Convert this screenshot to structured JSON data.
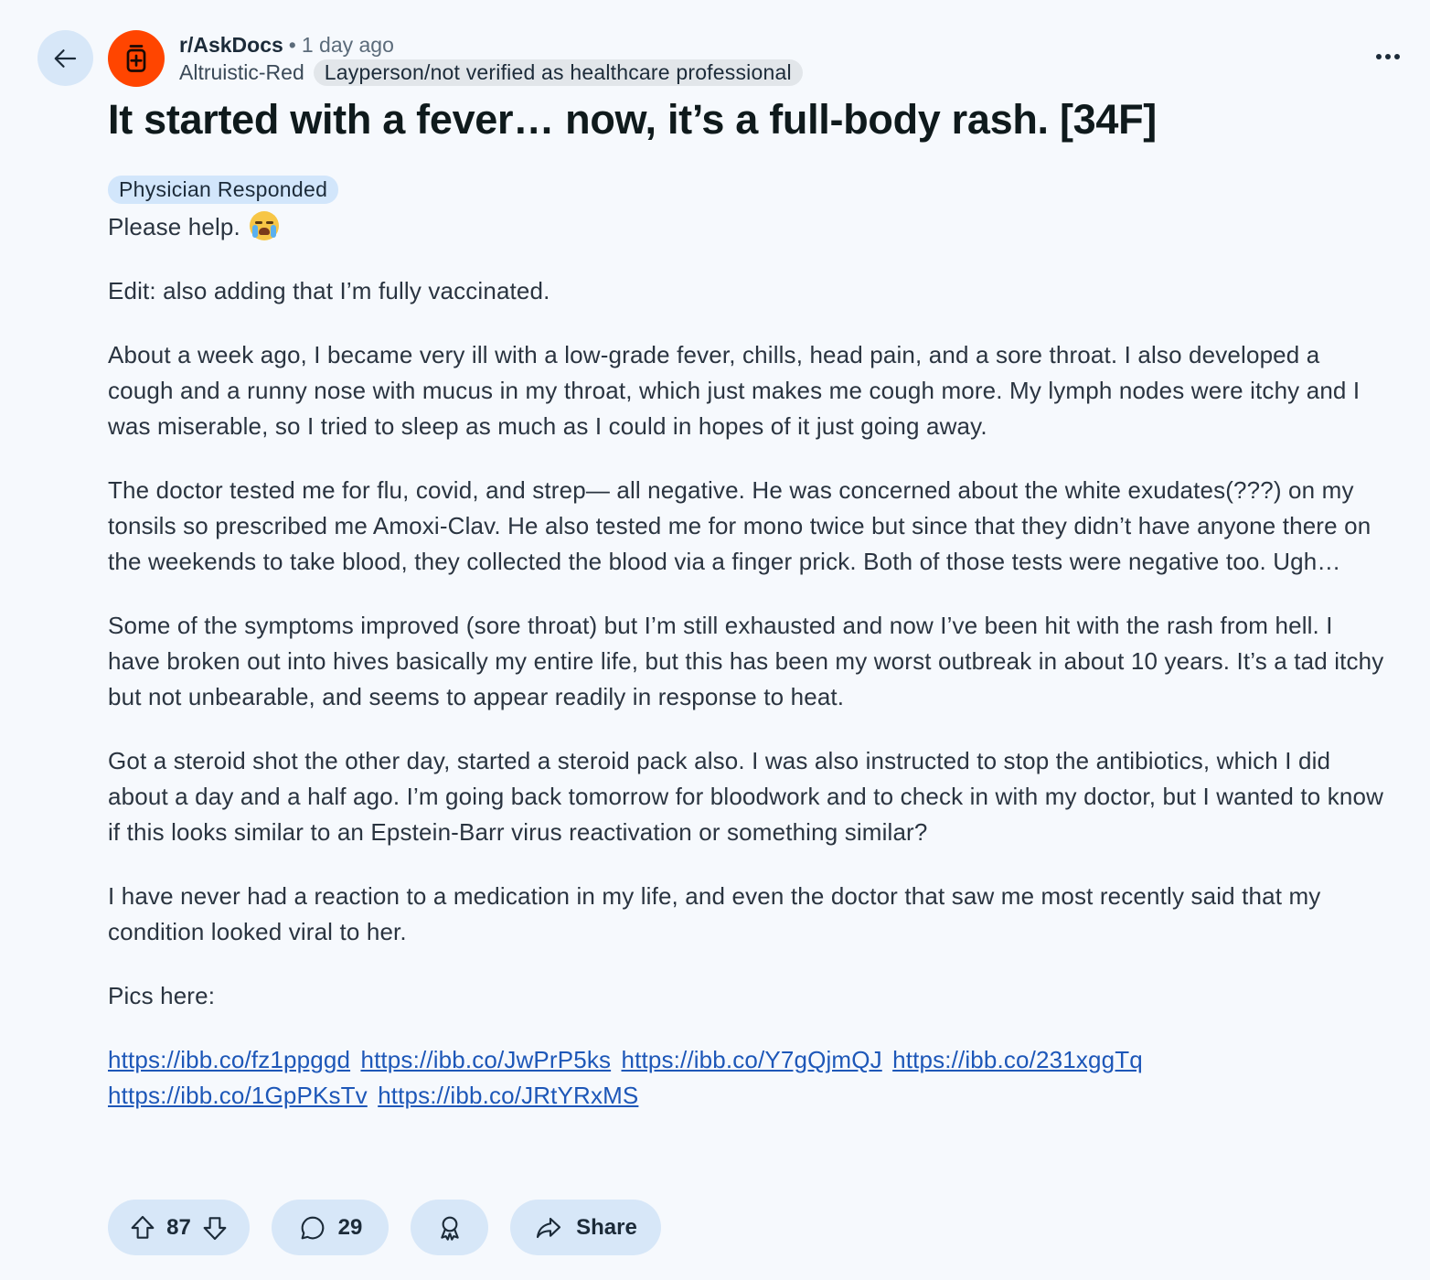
{
  "header": {
    "subreddit": "r/AskDocs",
    "separator": "•",
    "time_ago": "1 day ago",
    "author": "Altruistic-Red",
    "user_flair": "Layperson/not verified as healthcare professional",
    "avatar_color": "#ff4500"
  },
  "post": {
    "title": "It started with a fever… now, it’s a full-body rash. [34F]",
    "flair": "Physician Responded",
    "paragraphs": [
      "Please help.",
      "Edit: also adding that I’m fully vaccinated.",
      "About a week ago, I became very ill with a low-grade fever, chills, head pain, and a sore throat. I also developed a cough and a runny nose with mucus in my throat, which just makes me cough more. My lymph nodes were itchy and I was miserable, so I tried to sleep as much as I could in hopes of it just going away.",
      "The doctor tested me for flu, covid, and strep— all negative. He was concerned about the white exudates(???) on my tonsils so prescribed me Amoxi-Clav. He also tested me for mono twice but since that they didn’t have anyone there on the weekends to take blood, they collected the blood via a finger prick. Both of those tests were negative too. Ugh…",
      "Some of the symptoms improved (sore throat) but I’m still exhausted and now I’ve been hit with the rash from hell. I have broken out into hives basically my entire life, but this has been my worst outbreak in about 10 years. It’s a tad itchy but not unbearable, and seems to appear readily in response to heat.",
      "Got a steroid shot the other day, started a steroid pack also. I was also instructed to stop the antibiotics, which I did about a day and a half ago. I’m going back tomorrow for bloodwork and to check in with my doctor, but I wanted to know if this looks similar to an Epstein-Barr virus reactivation or something similar?",
      "I have never had a reaction to a medication in my life, and even the doctor that saw me most recently said that my condition looked viral to her.",
      "Pics here:"
    ],
    "links": [
      "https://ibb.co/fz1ppggd",
      "https://ibb.co/JwPrP5ks",
      "https://ibb.co/Y7gQjmQJ",
      "https://ibb.co/231xggTq",
      "https://ibb.co/1GpPKsTv",
      "https://ibb.co/JRtYRxMS"
    ]
  },
  "actions": {
    "vote_count": "87",
    "comment_count": "29",
    "share_label": "Share"
  },
  "colors": {
    "background": "#f6f9fd",
    "pill": "#d7e7f8",
    "flair": "#d2e6fb",
    "link": "#1d57b8"
  }
}
